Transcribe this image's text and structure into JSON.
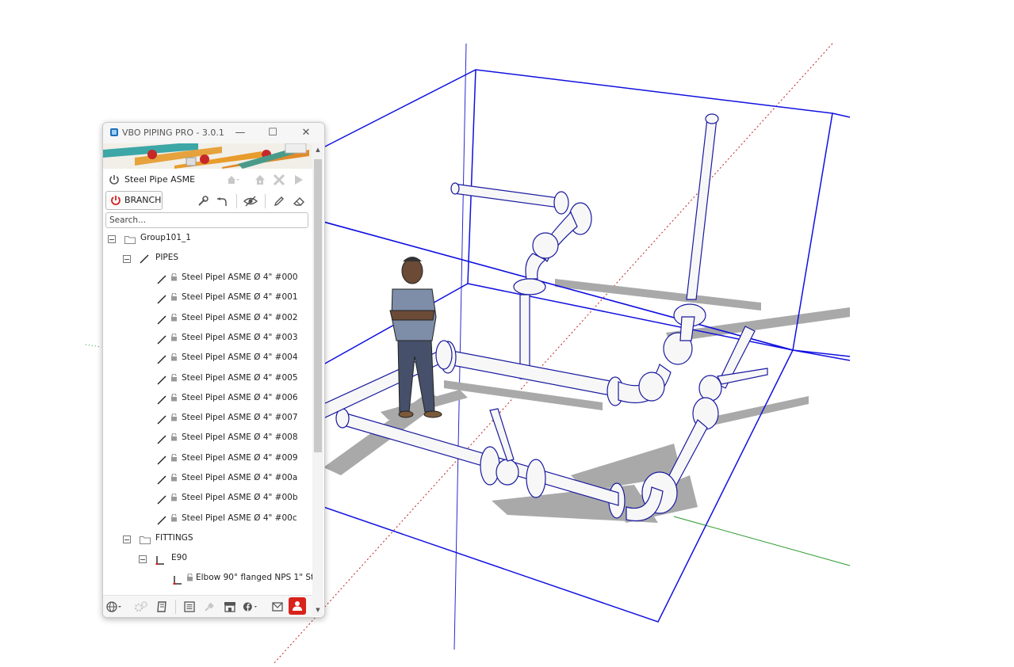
{
  "window": {
    "title": "VBO PIPING PRO - 3.0.1",
    "minimize_icon": "minimize-icon",
    "maximize_icon": "maximize-icon",
    "close_icon": "close-icon"
  },
  "toolbar": {
    "catalog_name": "Steel Pipe ASME",
    "branch_label": "BRANCH",
    "icons": [
      "power-icon",
      "home-icon",
      "settings-icon",
      "tools-icon",
      "play-icon",
      "wrench-icon",
      "fitting-icon",
      "hide-icon",
      "pencil-icon",
      "eraser-icon"
    ]
  },
  "search": {
    "placeholder": "Search...",
    "value": ""
  },
  "tree": {
    "root": {
      "label": "Group101_1"
    },
    "pipes": {
      "label": "PIPES",
      "items": [
        "Steel Pipel ASME Ø 4\" #000",
        "Steel Pipel ASME Ø 4\" #001",
        "Steel Pipel ASME Ø 4\" #002",
        "Steel Pipel ASME Ø 4\" #003",
        "Steel Pipel ASME Ø 4\" #004",
        "Steel Pipel ASME Ø 4\" #005",
        "Steel Pipel ASME Ø 4\" #006",
        "Steel Pipel ASME Ø 4\" #007",
        "Steel Pipel ASME Ø 4\" #008",
        "Steel Pipel ASME Ø 4\" #009",
        "Steel Pipel ASME Ø 4\" #00a",
        "Steel Pipel ASME Ø 4\" #00b",
        "Steel Pipel ASME Ø 4\" #00c"
      ]
    },
    "fittings": {
      "label": "FITTINGS",
      "e90": {
        "label": "E90",
        "items": [
          "Elbow 90° flanged NPS 1\" St"
        ]
      }
    }
  },
  "bottom_bar": {
    "icons": [
      "globe-icon",
      "gears-icon",
      "book-icon",
      "list-icon",
      "plug-icon",
      "store-icon",
      "facebook-icon",
      "mail-icon",
      "user-icon"
    ]
  },
  "colors": {
    "selection_blue": "#1010e0",
    "pipe_outline": "#1a1aa0",
    "shadow": "#a6a6a6",
    "power_red": "#d42020",
    "user_button": "#d9221c"
  }
}
